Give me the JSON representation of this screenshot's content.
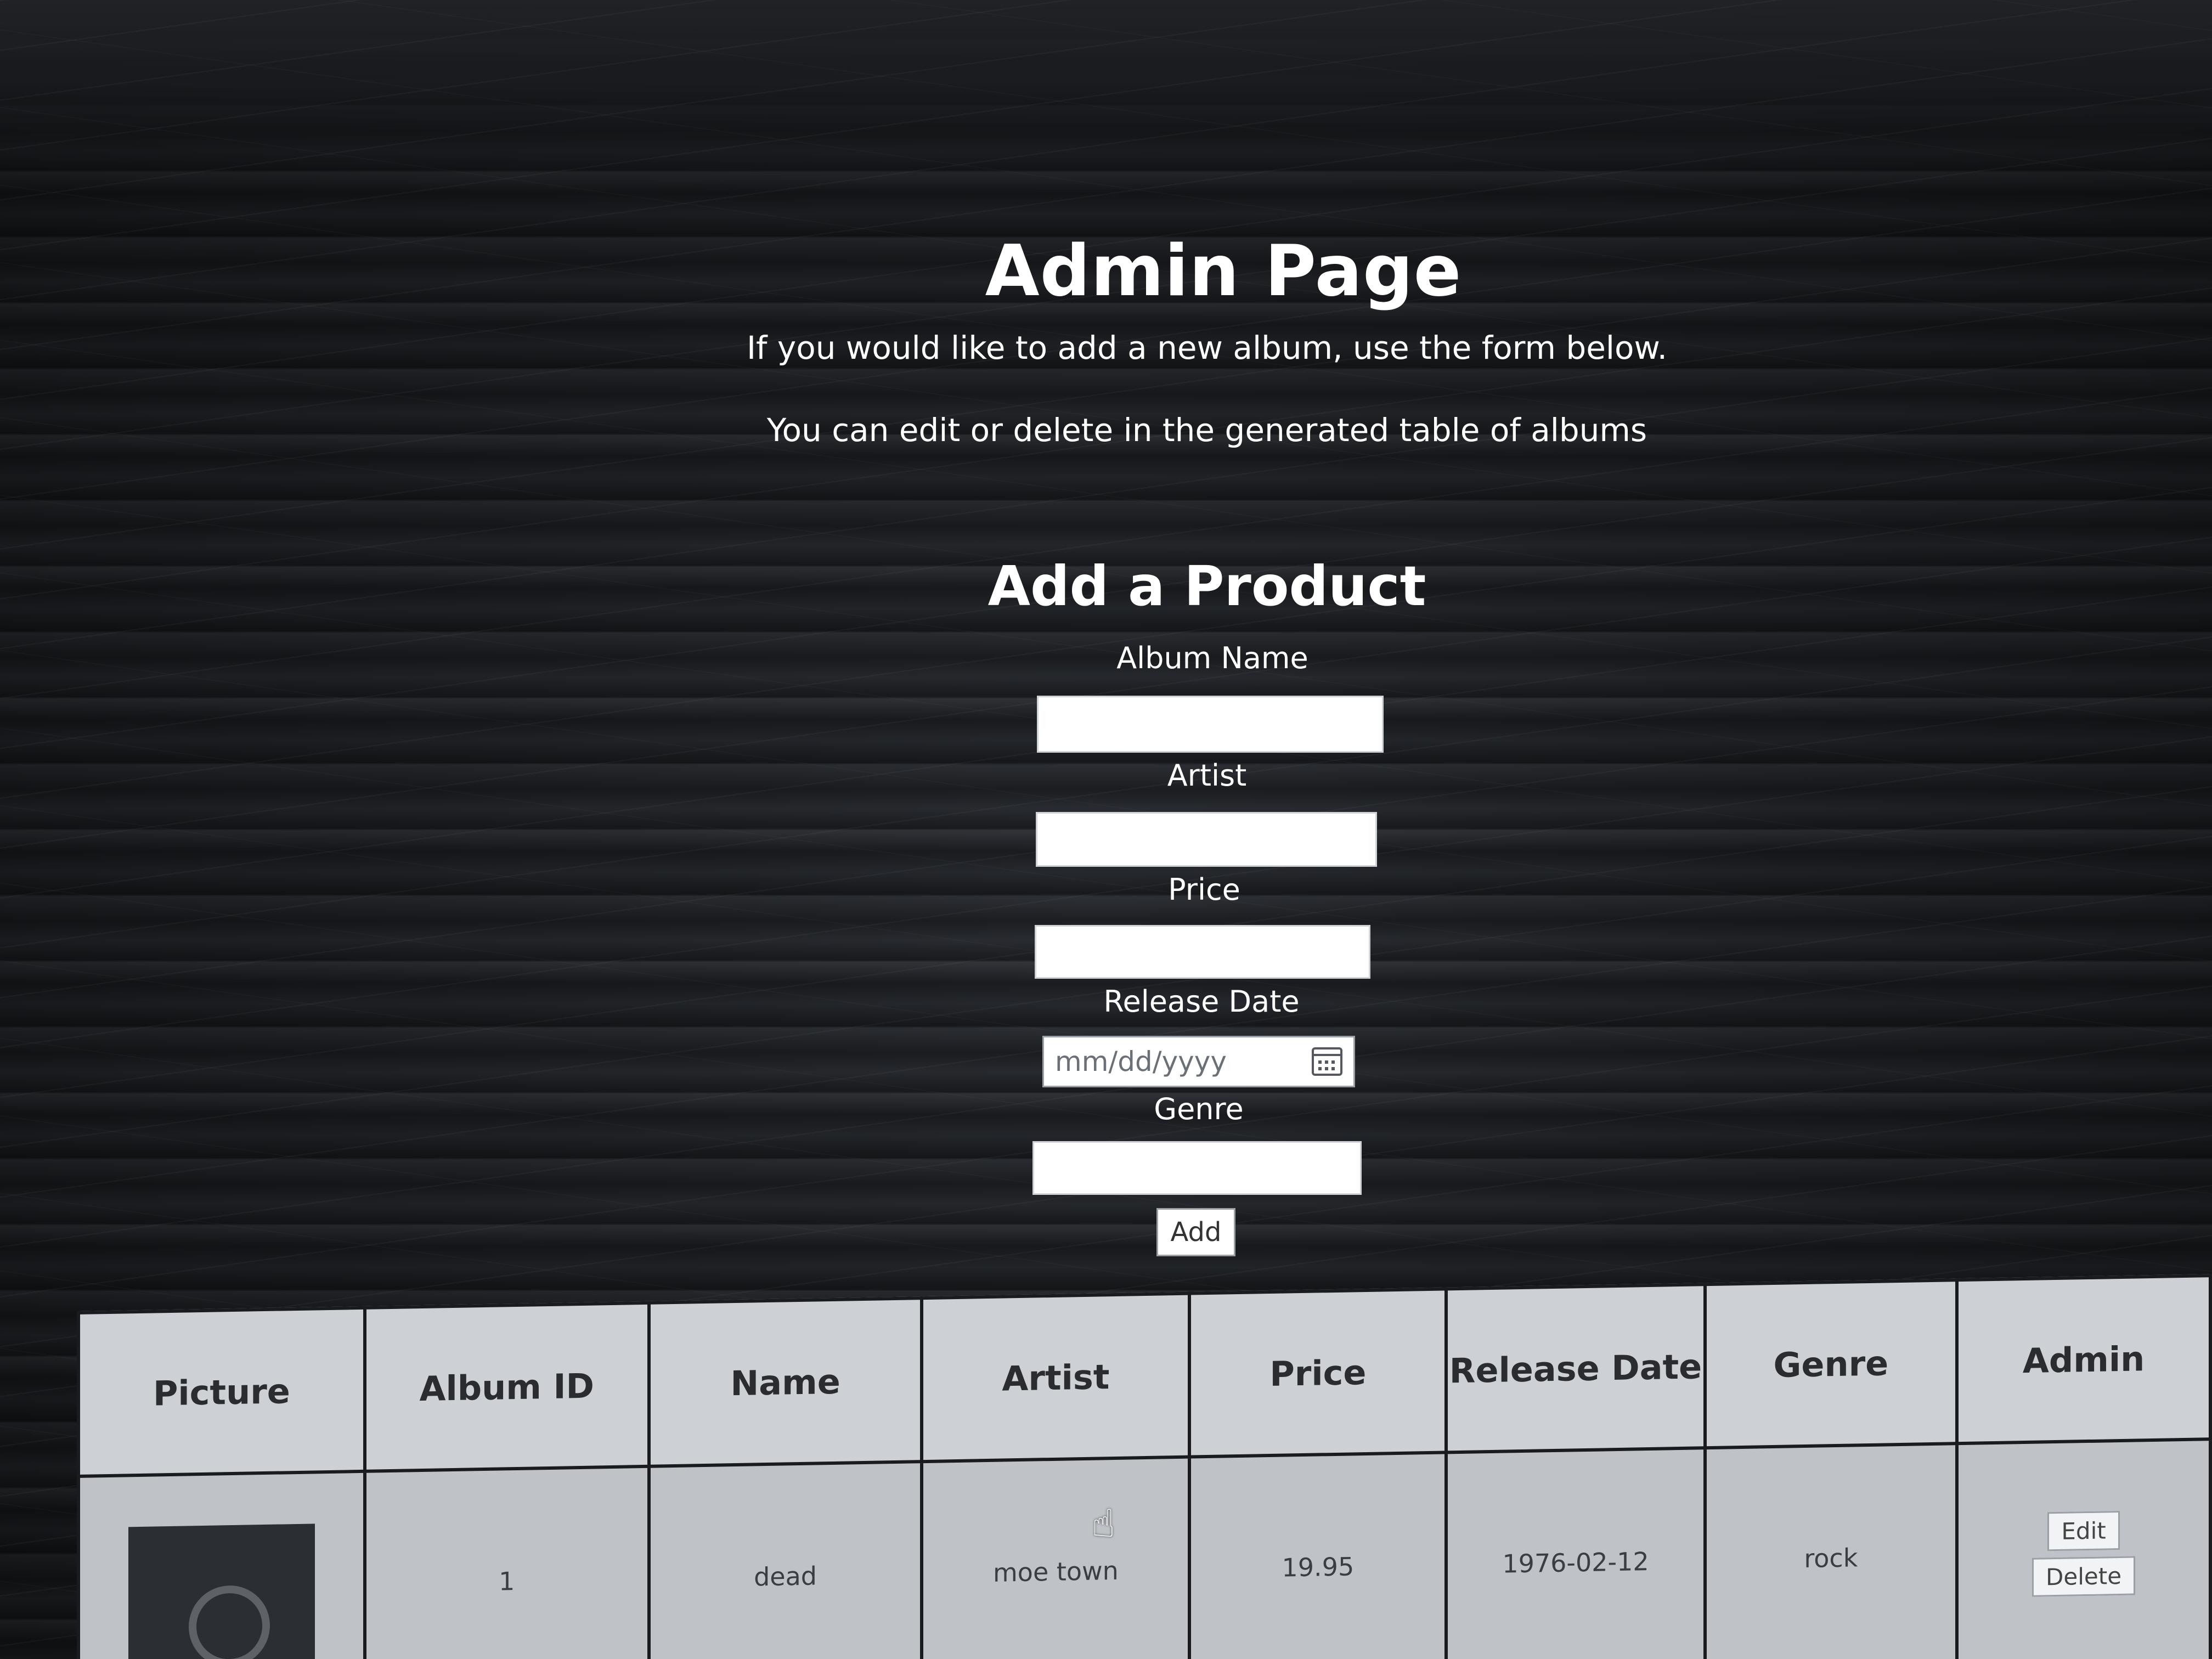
{
  "page": {
    "title": "Admin Page",
    "intro_line1": "If you would like to add a new album, use the form below.",
    "intro_line2": "You can edit or delete in the generated table of albums"
  },
  "form": {
    "title": "Add a Product",
    "album_name_label": "Album Name",
    "artist_label": "Artist",
    "price_label": "Price",
    "release_date_label": "Release Date",
    "release_date_placeholder": "mm/dd/yyyy",
    "genre_label": "Genre",
    "add_button": "Add"
  },
  "table": {
    "headers": [
      "Picture",
      "Album ID",
      "Name",
      "Artist",
      "Price",
      "Release Date",
      "Genre",
      "Admin"
    ],
    "rows": [
      {
        "album_id": "1",
        "name": "dead",
        "artist": "moe town",
        "price": "19.95",
        "release_date": "1976-02-12",
        "genre": "rock",
        "edit_label": "Edit",
        "delete_label": "Delete"
      }
    ]
  },
  "colors": {
    "background": "#1d1f23",
    "text": "#ffffff",
    "table_background": "#c9ccd0",
    "table_border": "#1a1b1e"
  }
}
